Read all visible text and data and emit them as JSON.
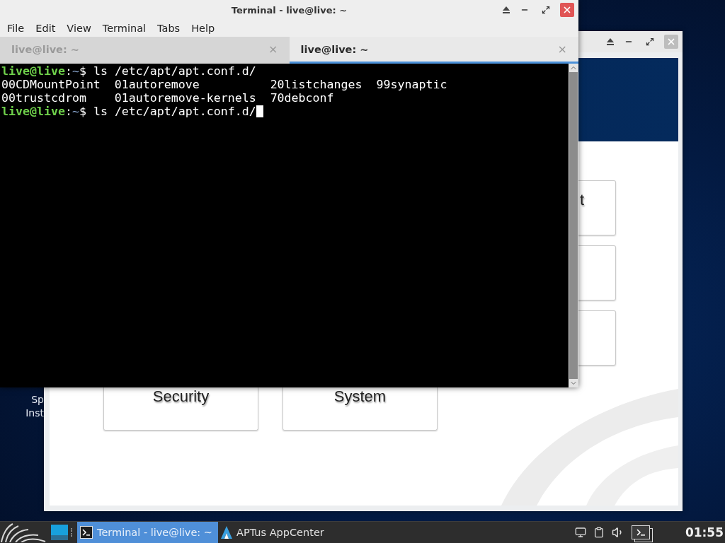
{
  "desktop_icon": {
    "lines": [
      "Sp",
      "Inst"
    ]
  },
  "appcenter_window": {
    "right_column_cards": [
      {
        "kind": "text",
        "label": "t"
      },
      {
        "kind": "blank"
      },
      {
        "kind": "blank"
      }
    ],
    "bottom_row_cards": [
      {
        "kind": "text",
        "label": "Security"
      },
      {
        "kind": "text",
        "label": "System"
      }
    ]
  },
  "terminal": {
    "title": "Terminal - live@live: ~",
    "menu": [
      "File",
      "Edit",
      "View",
      "Terminal",
      "Tabs",
      "Help"
    ],
    "tabs": [
      {
        "label": "live@live: ~",
        "selected": false,
        "close": "×"
      },
      {
        "label": "live@live: ~",
        "selected": true,
        "close": "×"
      }
    ],
    "lines": [
      {
        "kind": "prompt",
        "user": "live@live",
        "separator": ":",
        "path": "~",
        "symbol": "$",
        "command": " ls /etc/apt/apt.conf.d/",
        "cursor": false
      },
      {
        "kind": "output",
        "text": "00CDMountPoint  01autoremove          20listchanges  99synaptic"
      },
      {
        "kind": "output",
        "text": "00trustcdrom    01autoremove-kernels  70debconf"
      },
      {
        "kind": "prompt",
        "user": "live@live",
        "separator": ":",
        "path": "~",
        "symbol": "$",
        "command": " ls /etc/apt/apt.conf.d/",
        "cursor": true
      }
    ]
  },
  "taskbar": {
    "tasks": [
      {
        "kind": "terminal",
        "label": "Terminal - live@live: ~",
        "selected": true
      },
      {
        "kind": "appcenter",
        "label": "APTus AppCenter",
        "selected": false
      }
    ],
    "clock": "01:55"
  }
}
